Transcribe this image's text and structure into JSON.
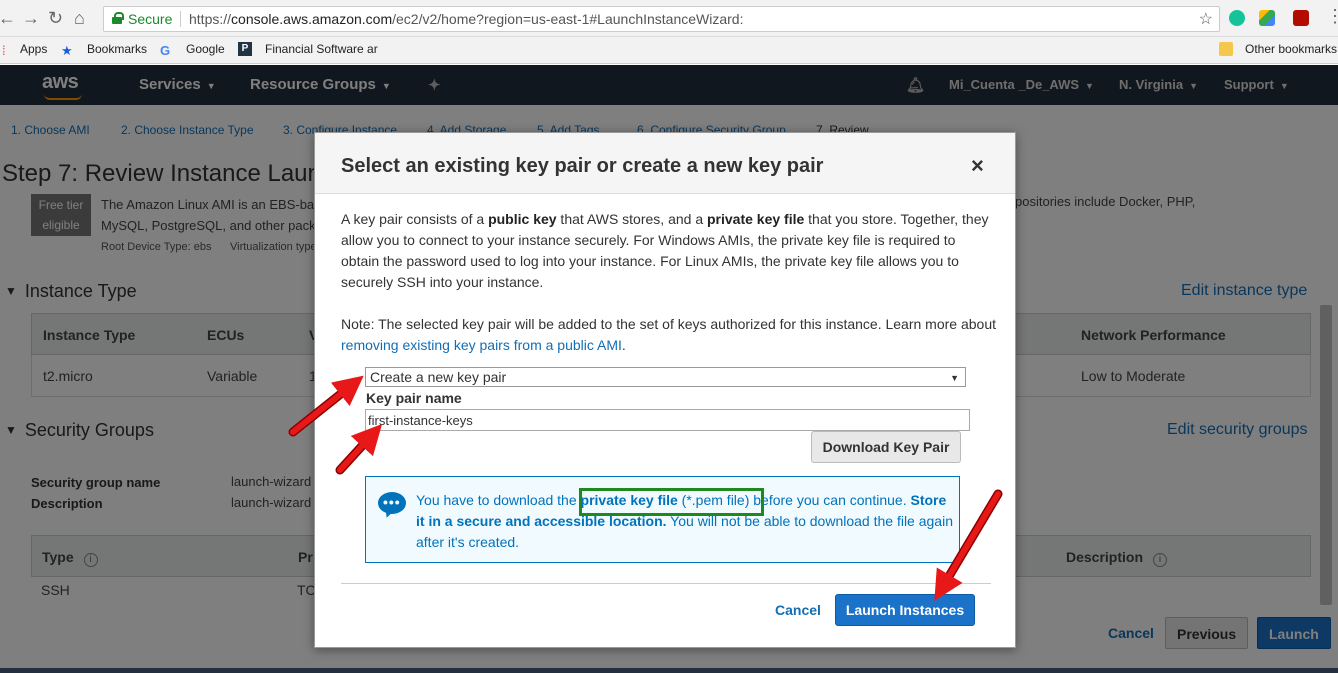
{
  "browser": {
    "secure_label": "Secure",
    "url_scheme": "https://",
    "url_host": "console.aws.amazon.com",
    "url_path": "/ec2/v2/home?region=us-east-1#LaunchInstanceWizard:",
    "bookmarks": [
      "Apps",
      "Bookmarks",
      "Google",
      "Financial Software ar"
    ],
    "other_bookmarks": "Other bookmarks"
  },
  "aws_nav": {
    "logo": "aws",
    "services": "Services",
    "resource_groups": "Resource Groups",
    "account": "Mi_Cuenta _De_AWS",
    "region": "N. Virginia",
    "support": "Support"
  },
  "wizard": {
    "steps": [
      "1. Choose AMI",
      "2. Choose Instance Type",
      "3. Configure Instance",
      "4. Add Storage",
      "5. Add Tags",
      "6. Configure Security Group",
      "7. Review"
    ],
    "title": "Step 7: Review Instance Laun",
    "free_tier": [
      "Free tier",
      "eligible"
    ],
    "ami_desc_line1": "The Amazon Linux AMI is an EBS-ba",
    "ami_desc_line2": "MySQL, PostgreSQL, and other pack",
    "ami_desc_right": "positories include Docker, PHP,",
    "root_device": "Root Device Type: ebs",
    "virtualization": "Virtualization type"
  },
  "instance_type": {
    "heading": "Instance Type",
    "edit": "Edit instance type",
    "headers": [
      "Instance Type",
      "ECUs",
      "V",
      "Network Performance"
    ],
    "row": [
      "t2.micro",
      "Variable",
      "1",
      "Low to Moderate"
    ]
  },
  "security_groups": {
    "heading": "Security Groups",
    "edit": "Edit security groups",
    "name_label": "Security group name",
    "name_value": "launch-wizard",
    "desc_label": "Description",
    "desc_value": "launch-wizard",
    "headers": [
      "Type",
      "Pr",
      "Description"
    ],
    "row": [
      "SSH",
      "TC"
    ]
  },
  "footer": {
    "cancel": "Cancel",
    "previous": "Previous",
    "launch": "Launch"
  },
  "modal": {
    "title": "Select an existing key pair or create a new key pair",
    "close": "×",
    "p1_a": "A key pair consists of a ",
    "p1_b": "public key",
    "p1_c": " that AWS stores, and a ",
    "p1_d": "private key file",
    "p1_e": " that you store. Together, they allow you to connect to your instance securely. For Windows AMIs, the private key file is required to obtain the password used to log into your instance. For Linux AMIs, the private key file allows you to securely SSH into your instance.",
    "p2_a": "Note: The selected key pair will be added to the set of keys authorized for this instance. Learn more about ",
    "p2_link": "removing existing key pairs from a public AMI",
    "p2_b": ".",
    "select_value": "Create a new key pair",
    "key_pair_label": "Key pair name",
    "key_pair_value": "first-instance-keys",
    "download_button": "Download Key Pair",
    "info_a": "You have to download the ",
    "info_b": "private key file",
    "info_c": " (*.pem file) before you can continue. ",
    "info_d": "Store it in a secure and accessible location.",
    "info_e": " You will not be able to download the file again after it's created.",
    "cancel": "Cancel",
    "launch": "Launch Instances"
  },
  "colors": {
    "aws_nav": "#232f3e",
    "link": "#146eb4",
    "primary_button": "#1a73c9",
    "highlight_box": "#1e8a1e",
    "annotation_arrow": "#e81818"
  }
}
